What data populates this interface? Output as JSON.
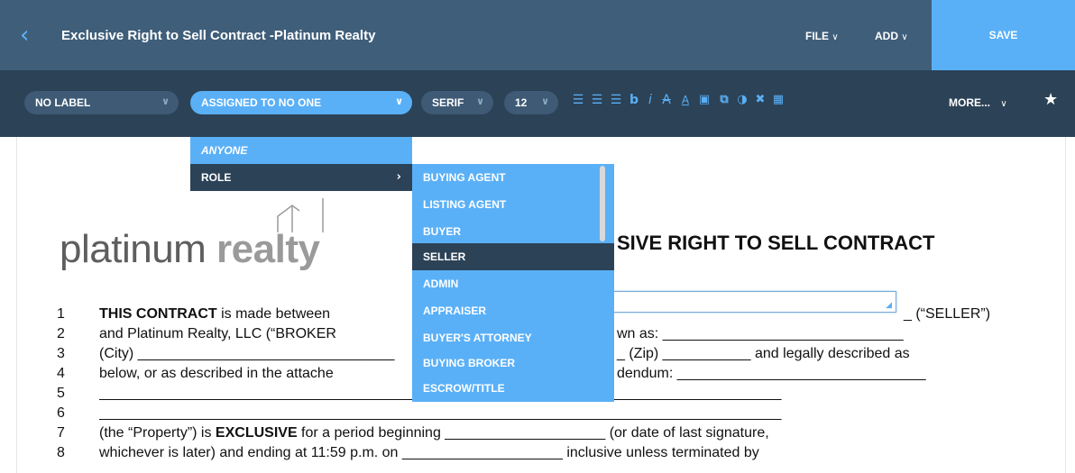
{
  "header": {
    "back_icon": "chevron-left-icon",
    "title": "Exclusive Right to Sell Contract -Platinum Realty",
    "file_label": "FILE",
    "add_label": "ADD",
    "save_label": "SAVE",
    "chev": "∨"
  },
  "toolbar": {
    "label_select": "NO LABEL",
    "assign_select": "ASSIGNED TO NO ONE",
    "font_select": "SERIF",
    "size_select": "12",
    "more_label": "MORE...",
    "chev": "∨",
    "format_icons": [
      "align-left-icon",
      "align-center-icon",
      "align-right-icon",
      "bold-icon",
      "italic-icon",
      "strikethrough-icon",
      "underline-icon",
      "stamp-icon",
      "copy-icon",
      "contrast-icon",
      "delete-icon",
      "calculator-icon",
      "star-icon"
    ],
    "bold_glyph": "b",
    "italic_glyph": "i",
    "strike_glyph": "A",
    "underline_glyph": "A",
    "delete_glyph": "✖",
    "star_glyph": "★"
  },
  "assign_menu": {
    "anyone": "ANYONE",
    "role": "ROLE",
    "role_arrow": "›",
    "roles": [
      "BUYING AGENT",
      "LISTING AGENT",
      "BUYER",
      "SELLER",
      "ADMIN",
      "APPRAISER",
      "BUYER'S ATTORNEY",
      "BUYING BROKER",
      "ESCROW/TITLE"
    ],
    "selected_role": "SELLER"
  },
  "document": {
    "logo_word1": "platinum ",
    "logo_word2": "realty",
    "heading": "SIVE RIGHT TO SELL CONTRACT",
    "lines": [
      {
        "n": "1",
        "text_a_bold": "THIS CONTRACT",
        "text_a": " is made between",
        "text_b": "_ (“SELLER”)"
      },
      {
        "n": "2",
        "text_a": "and Platinum Realty, LLC (“BROKER",
        "text_b": "wn as: ______________________________"
      },
      {
        "n": "3",
        "text_a": "(City) ________________________________",
        "text_b": "_ (Zip) ___________ and legally described as"
      },
      {
        "n": "4",
        "text_a": "below, or as described in the attache",
        "text_b": "dendum: _______________________________"
      },
      {
        "n": "5",
        "text_a": "_____________________________________________________________________________________"
      },
      {
        "n": "6",
        "text_a": "_____________________________________________________________________________________"
      },
      {
        "n": "7",
        "text_a": "(the “Property”) is ",
        "text_a_bold2": "EXCLUSIVE",
        "text_a2": " for a period beginning ____________________ (or date of last signature,"
      },
      {
        "n": "8",
        "text_a": "whichever is later) and ending at 11:59 p.m. on ____________________ inclusive unless terminated by"
      }
    ]
  }
}
